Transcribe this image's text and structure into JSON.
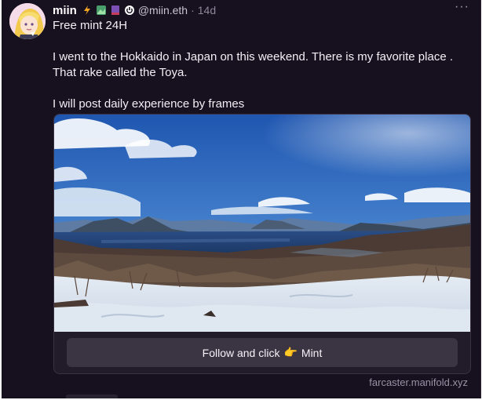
{
  "post": {
    "display_name": "miin",
    "handle": "@miin.eth",
    "separator": "·",
    "age": "14d",
    "more_label": "···",
    "lines": [
      "Free mint 24H",
      "I went to the Hokkaido in Japan on this weekend. There is my favorite place . That rake called the Toya.",
      "I will post daily experience by frames"
    ]
  },
  "badges": [
    "lightning-badge",
    "image-badge",
    "flag-badge",
    "power-badge"
  ],
  "frame": {
    "button_text": "Follow and click",
    "button_icon": "👉",
    "button_action": "Mint",
    "domain": "farcaster.manifold.xyz"
  },
  "colors": {
    "background": "#17101f",
    "text": "#f2eff5",
    "muted": "#9a92a4",
    "button": "#3b3443"
  }
}
